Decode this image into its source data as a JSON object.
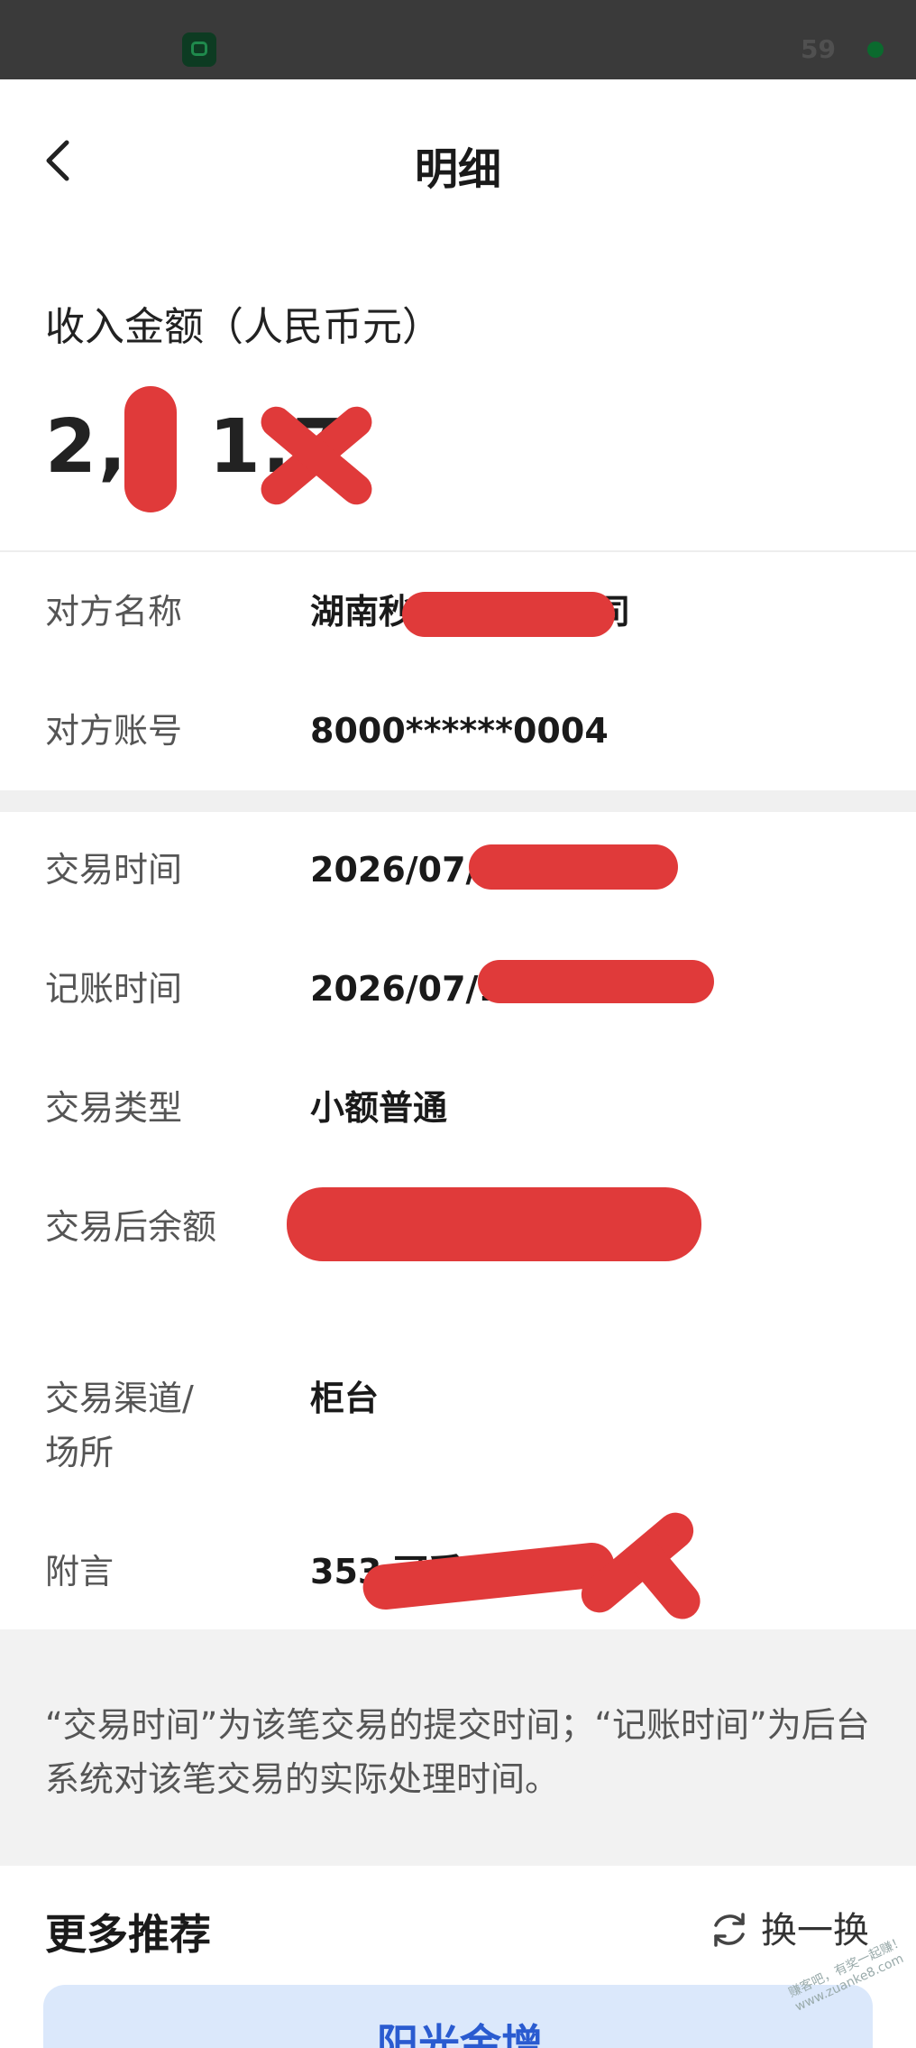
{
  "status_bar": {
    "number": "59"
  },
  "header": {
    "back_icon": "chevron-left-icon",
    "title": "明细"
  },
  "amount": {
    "label": "收入金额（人民币元）",
    "value": "2,0 1.7"
  },
  "counterparty": [
    {
      "label": "对方名称",
      "value": "湖南秒        销售有限公司"
    },
    {
      "label": "对方账号",
      "value": "8000******0004"
    }
  ],
  "details": [
    {
      "label": "交易时间",
      "value": "2026/07/              2"
    },
    {
      "label": "记账时间",
      "value": "2026/07/1"
    },
    {
      "label": "交易类型",
      "value": "小额普通"
    },
    {
      "label": "交易后余额",
      "value": ""
    },
    {
      "label": "交易渠道/场所",
      "value": "柜台"
    },
    {
      "label": "附言",
      "value": "353               可孚呼吸机"
    }
  ],
  "note": "“交易时间”为该笔交易的提交时间；“记账时间”为后台系统对该笔交易的实际处理时间。",
  "more": {
    "title": "更多推荐",
    "swap_label": "换一换",
    "swap_icon": "refresh-icon",
    "card_title": "阳光金增"
  },
  "watermark": "赚客吧，有奖一起赚！ www.zuanke8.com",
  "colors": {
    "redaction": "#e03a3a",
    "background": "#ffffff",
    "gap": "#f0f0f0"
  }
}
